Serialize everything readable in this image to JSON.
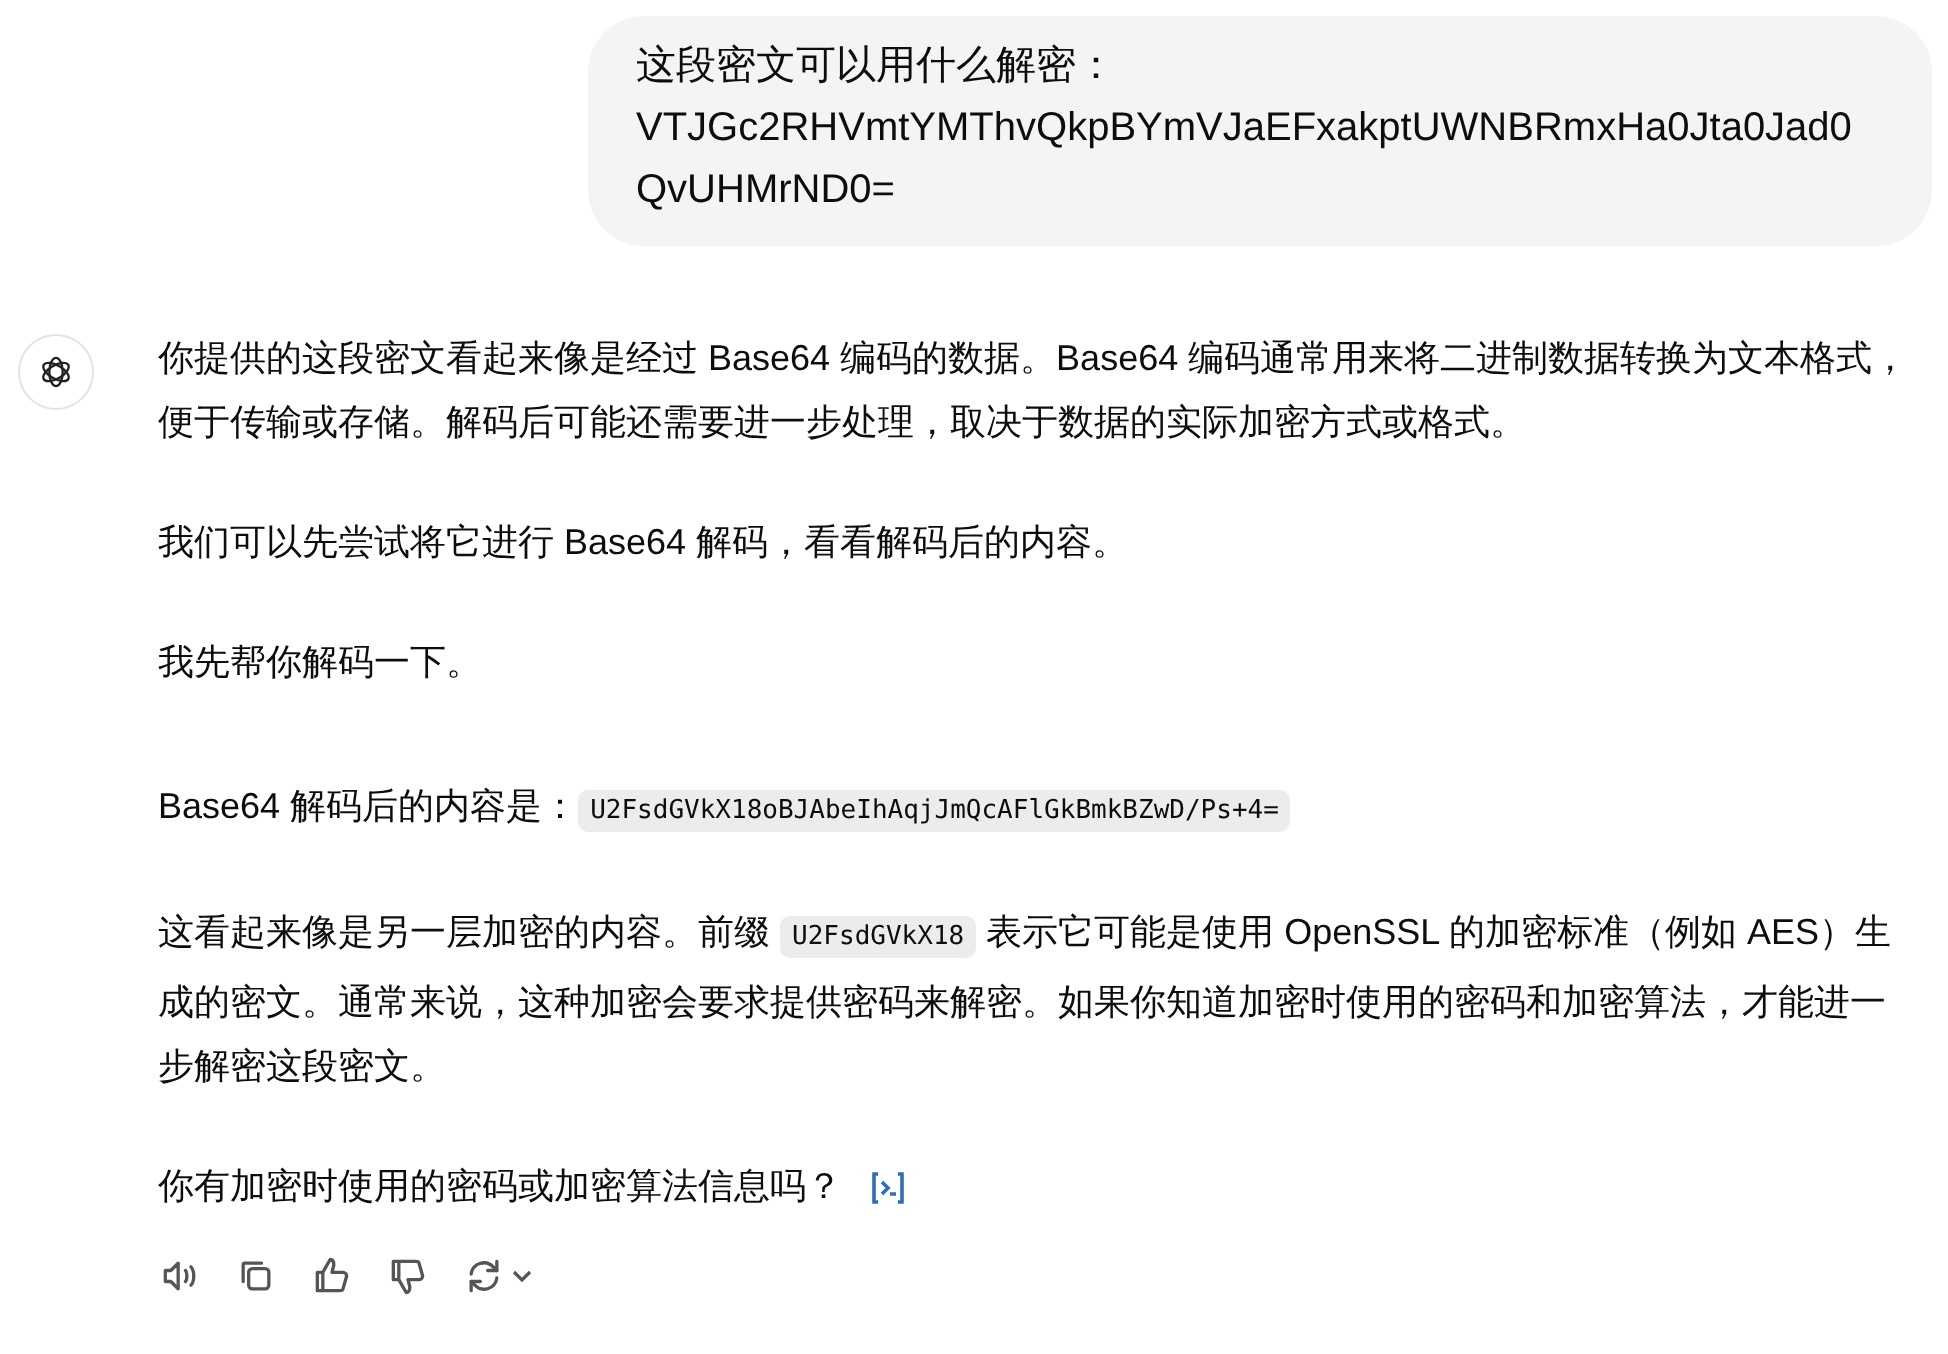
{
  "user_message": {
    "lines": [
      "这段密文可以用什么解密：",
      "VTJGc2RHVmtYMThvQkpBYmVJaEFxakptUWNBRmxHa0Jta0Jad0QvUHMrND0="
    ]
  },
  "assistant_message": {
    "paragraphs": [
      {
        "parts": [
          {
            "kind": "text",
            "text": "你提供的这段密文看起来像是经过 Base64 编码的数据。Base64 编码通常用来将二进制数据转换为文本格式，便于传输或存储。解码后可能还需要进一步处理，取决于数据的实际加密方式或格式。"
          }
        ]
      },
      {
        "parts": [
          {
            "kind": "text",
            "text": "我们可以先尝试将它进行 Base64 解码，看看解码后的内容。"
          }
        ]
      },
      {
        "parts": [
          {
            "kind": "text",
            "text": "我先帮你解码一下。"
          }
        ]
      },
      {
        "parts": [
          {
            "kind": "text",
            "text": "Base64 解码后的内容是："
          },
          {
            "kind": "code",
            "text": "U2FsdGVkX18oBJAbeIhAqjJmQcAFlGkBmkBZwD/Ps+4="
          }
        ]
      },
      {
        "parts": [
          {
            "kind": "text",
            "text": "这看起来像是另一层加密的内容。前缀 "
          },
          {
            "kind": "code",
            "text": "U2FsdGVkX18"
          },
          {
            "kind": "text",
            "text": " 表示它可能是使用 OpenSSL 的加密标准（例如 AES）生成的密文。通常来说，这种加密会要求提供密码来解密。如果你知道加密时使用的密码和加密算法，才能进一步解密这段密文。"
          }
        ]
      },
      {
        "parts": [
          {
            "kind": "text",
            "text": "你有加密时使用的密码或加密算法信息吗？"
          },
          {
            "kind": "badge"
          }
        ]
      }
    ]
  },
  "actions": [
    {
      "kind": "read"
    },
    {
      "kind": "copy"
    },
    {
      "kind": "like"
    },
    {
      "kind": "dislike"
    },
    {
      "kind": "regenerate"
    }
  ]
}
